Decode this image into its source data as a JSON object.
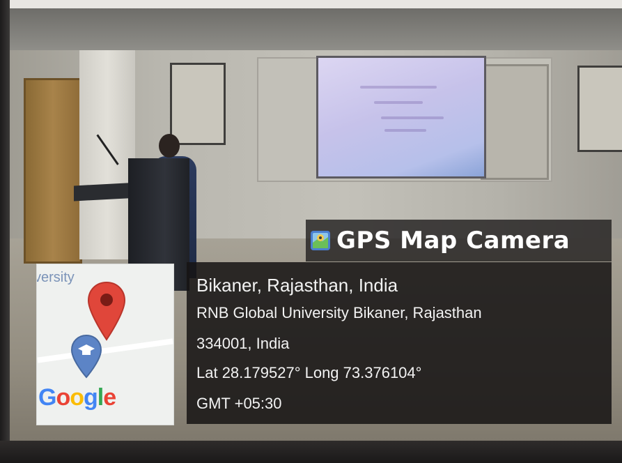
{
  "overlay": {
    "brand": {
      "icon": "map-app-icon",
      "title": "GPS Map Camera"
    },
    "location": {
      "city_line": "Bikaner, Rajasthan, India",
      "address_line1": "RNB Global University Bikaner, Rajasthan",
      "address_line2": "334001, India",
      "coordinates": "Lat 28.179527° Long 73.376104°",
      "timezone": "GMT +05:30"
    },
    "map_thumbnail": {
      "label_fragment": "versity",
      "pin_icons": [
        "red-location-pin-icon",
        "blue-graduation-cap-pin-icon"
      ]
    }
  },
  "colors": {
    "overlay_bg": "#231f1f",
    "overlay_text": "#f2f2f2",
    "pin_red": "#e0463a",
    "pin_blue": "#5c84c6",
    "google_blue": "#4285f4",
    "google_red": "#ea4335",
    "google_yellow": "#fbbc05",
    "google_green": "#34a853"
  }
}
